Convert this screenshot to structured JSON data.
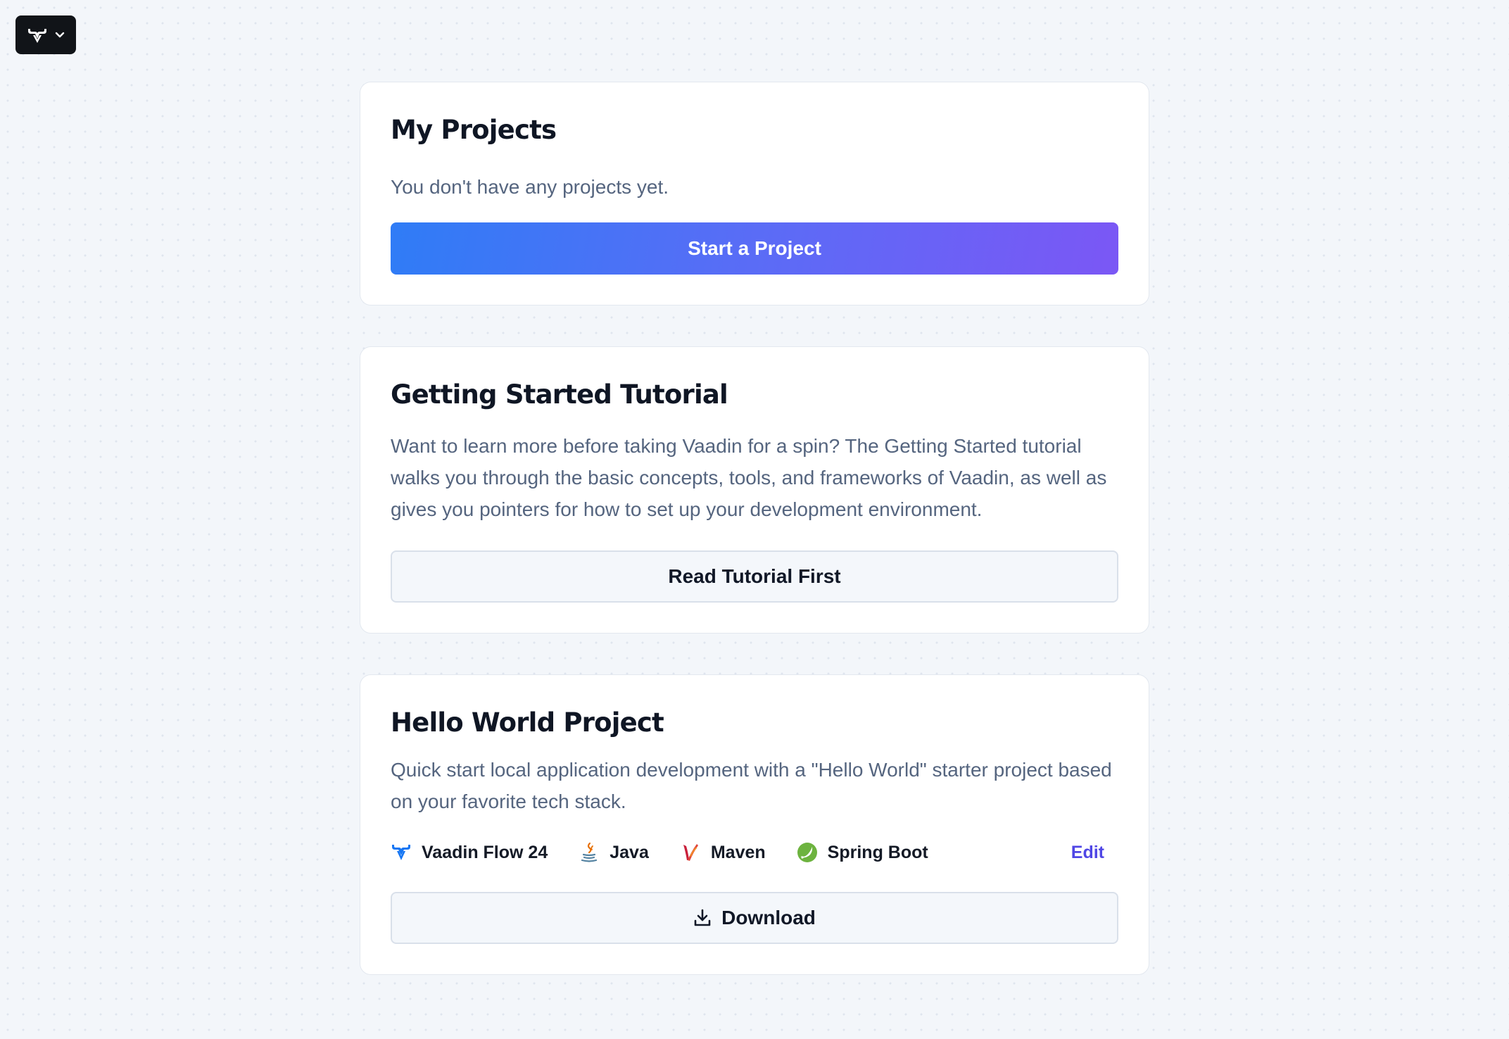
{
  "app_menu": {
    "logo_icon": "vaadin-logo-icon",
    "chevron_icon": "chevron-down-icon"
  },
  "my_projects": {
    "title": "My Projects",
    "empty_text": "You don't have any projects yet.",
    "start_button_label": "Start a Project"
  },
  "tutorial": {
    "title": "Getting Started Tutorial",
    "description": "Want to learn more before taking Vaadin for a spin? The Getting Started tutorial walks you through the basic concepts, tools, and frameworks of Vaadin, as well as gives you pointers for how to set up your development environment.",
    "button_label": "Read Tutorial First"
  },
  "hello_world": {
    "title": "Hello World Project",
    "description": "Quick start local application development with a \"Hello World\" starter project based on your favorite tech stack.",
    "stack": [
      {
        "label": "Vaadin Flow 24",
        "icon": "vaadin-icon"
      },
      {
        "label": "Java",
        "icon": "java-icon"
      },
      {
        "label": "Maven",
        "icon": "maven-icon"
      },
      {
        "label": "Spring Boot",
        "icon": "spring-boot-icon"
      }
    ],
    "edit_label": "Edit",
    "download_label": "Download",
    "download_icon": "download-icon"
  },
  "colors": {
    "background": "#f3f6fa",
    "primary_gradient_start": "#2f7cf6",
    "primary_gradient_end": "#7b57f5",
    "link": "#4f46e5",
    "muted_text": "#55657f"
  }
}
